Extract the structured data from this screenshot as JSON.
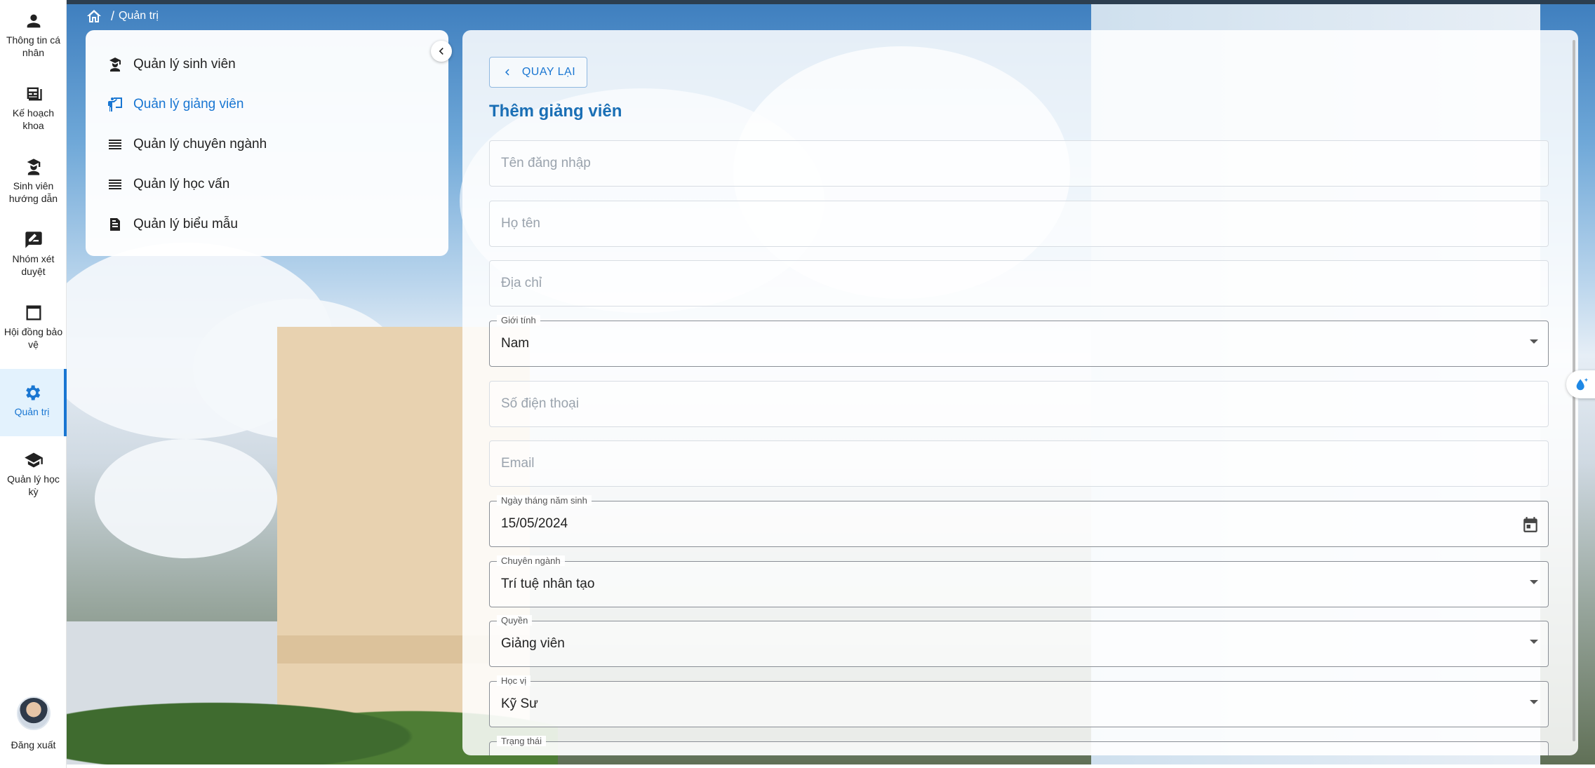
{
  "nav": {
    "items": [
      {
        "label": "Thông tin cá nhân",
        "icon": "person-icon"
      },
      {
        "label": "Kế hoạch khoa",
        "icon": "newspaper-icon"
      },
      {
        "label": "Sinh viên hướng dẫn",
        "icon": "student-icon"
      },
      {
        "label": "Nhóm xét duyệt",
        "icon": "rate-review-icon"
      },
      {
        "label": "Hội đồng bảo vệ",
        "icon": "window-icon"
      },
      {
        "label": "Quản trị",
        "icon": "gear-icon",
        "active": true
      },
      {
        "label": "Quản lý học kỳ",
        "icon": "graduation-cap-icon"
      }
    ],
    "logout_label": "Đăng xuất"
  },
  "breadcrumb": {
    "current": "Quản trị",
    "separator": "/"
  },
  "submenu": {
    "items": [
      {
        "label": "Quản lý sinh viên",
        "icon": "student-icon"
      },
      {
        "label": "Quản lý giảng viên",
        "icon": "teacher-icon",
        "active": true
      },
      {
        "label": "Quản lý chuyên ngành",
        "icon": "list-icon"
      },
      {
        "label": "Quản lý học vấn",
        "icon": "list-icon"
      },
      {
        "label": "Quản lý biểu mẫu",
        "icon": "document-icon"
      }
    ]
  },
  "form": {
    "back_label": "QUAY LẠI",
    "title": "Thêm giảng viên",
    "username_placeholder": "Tên đăng nhập",
    "fullname_placeholder": "Họ tên",
    "address_placeholder": "Địa chỉ",
    "gender": {
      "label": "Giới tính",
      "value": "Nam"
    },
    "phone_placeholder": "Số điện thoại",
    "email_placeholder": "Email",
    "birthday": {
      "label": "Ngày tháng năm sinh",
      "value": "15/05/2024"
    },
    "major": {
      "label": "Chuyên ngành",
      "value": "Trí tuệ nhân tạo"
    },
    "role": {
      "label": "Quyền",
      "value": "Giảng viên"
    },
    "degree": {
      "label": "Học vị",
      "value": "Kỹ Sư"
    },
    "status": {
      "label": "Trạng thái",
      "value": ""
    }
  },
  "colors": {
    "accent": "#1976d2",
    "title": "#1a6fb5"
  }
}
